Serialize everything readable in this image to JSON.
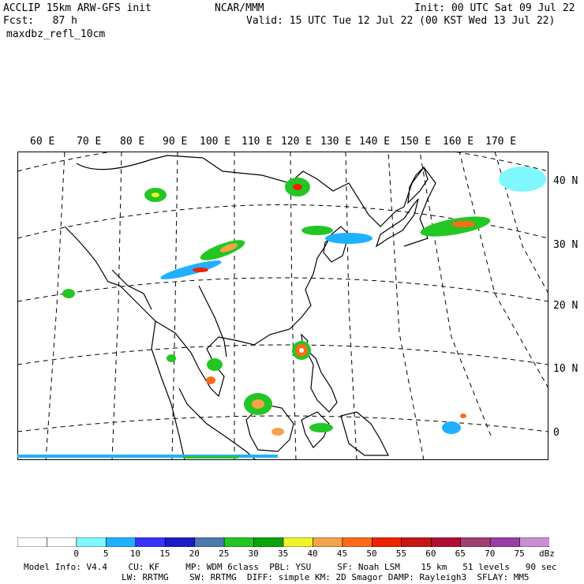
{
  "header": {
    "model_line": "ACCLIP 15km ARW-GFS init",
    "org": "NCAR/MMM",
    "init": "Init: 00 UTC Sat 09 Jul 22",
    "fcst": "Fcst:   87 h",
    "valid": "Valid: 15 UTC Tue 12 Jul 22 (00 KST Wed 13 Jul 22)",
    "field": "maxdbz_refl_10cm"
  },
  "lon_labels": [
    "60 E",
    "70 E",
    "80 E",
    "90 E",
    "100 E",
    "110 E",
    "120 E",
    "130 E",
    "140 E",
    "150 E",
    "160 E",
    "170 E"
  ],
  "lat_labels": [
    "40 N",
    "30 N",
    "20 N",
    "10 N",
    "0"
  ],
  "colorbar": {
    "unit": "dBz",
    "levels": [
      "0",
      "5",
      "10",
      "15",
      "20",
      "25",
      "30",
      "35",
      "40",
      "45",
      "50",
      "55",
      "60",
      "65",
      "70",
      "75"
    ],
    "colors": [
      "#ffffff",
      "#ffffff",
      "#7ff7ff",
      "#1fb0ff",
      "#3535ff",
      "#1c1cc8",
      "#4a7ab0",
      "#23c623",
      "#0aa40a",
      "#f2f22a",
      "#f5a24a",
      "#ff6a1a",
      "#ee2200",
      "#c81414",
      "#b01030",
      "#a04070",
      "#9a3ea6",
      "#c890d0"
    ]
  },
  "footer": {
    "line1": "Model Info: V4.4    CU: KF     MP: WDM 6class  PBL: YSU     SF: Noah LSM    15 km   51 levels   90 sec",
    "line2": "LW: RRTMG    SW: RRTMG  DIFF: simple KM: 2D Smagor DAMP: Rayleigh3  SFLAY: MM5"
  }
}
